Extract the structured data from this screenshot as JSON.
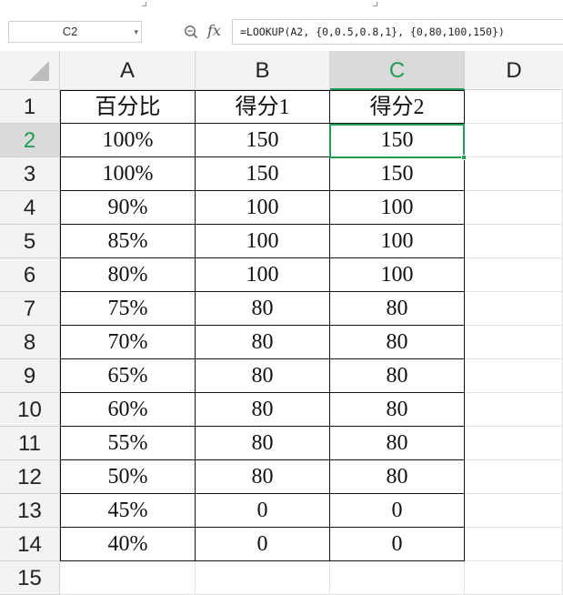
{
  "formula_bar": {
    "name_box": "C2",
    "fx_label": "fx",
    "formula": "=LOOKUP(A2, {0,0.5,0.8,1}, {0,80,100,150})"
  },
  "columns": [
    "A",
    "B",
    "C",
    "D"
  ],
  "selected_column": "C",
  "rows": [
    "1",
    "2",
    "3",
    "4",
    "5",
    "6",
    "7",
    "8",
    "9",
    "10",
    "11",
    "12",
    "13",
    "14",
    "15"
  ],
  "selected_row": "2",
  "table": {
    "headers": [
      "百分比",
      "得分1",
      "得分2"
    ],
    "data": [
      [
        "100%",
        "150",
        "150"
      ],
      [
        "100%",
        "150",
        "150"
      ],
      [
        "90%",
        "100",
        "100"
      ],
      [
        "85%",
        "100",
        "100"
      ],
      [
        "80%",
        "100",
        "100"
      ],
      [
        "75%",
        "80",
        "80"
      ],
      [
        "70%",
        "80",
        "80"
      ],
      [
        "65%",
        "80",
        "80"
      ],
      [
        "60%",
        "80",
        "80"
      ],
      [
        "55%",
        "80",
        "80"
      ],
      [
        "50%",
        "80",
        "80"
      ],
      [
        "45%",
        "0",
        "0"
      ],
      [
        "40%",
        "0",
        "0"
      ]
    ]
  },
  "colors": {
    "accent": "#1f9d55",
    "header_bg": "#f3f3f3",
    "selected_header_bg": "#dadada"
  }
}
